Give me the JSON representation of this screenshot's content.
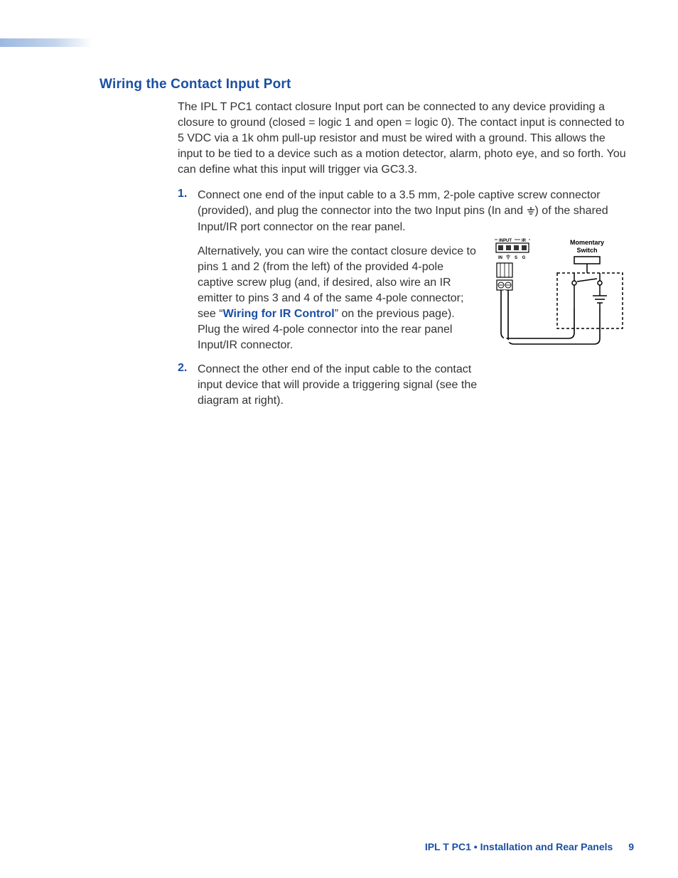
{
  "heading": "Wiring the Contact Input Port",
  "intro": "The IPL T PC1 contact closure Input port can be connected to any device providing a closure to ground (closed = logic 1 and open = logic 0). The contact input is connected to 5 VDC via a 1k ohm pull-up resistor and must be wired with a ground. This allows the input to be tied to a device such as a motion detector, alarm, photo eye, and so forth. You can define what this input will trigger via GC3.3.",
  "step1": {
    "num": "1.",
    "para1a": "Connect one end of the input cable to a 3.5 mm, 2-pole captive screw connector (provided), and plug the connector into the two Input pins (In and ",
    "para1b": ") of the shared Input/IR port connector on the rear panel.",
    "para2a": "Alternatively, you can wire the contact closure device to pins 1 and 2 (from the left) of the provided 4-pole captive screw plug (and, if desired, also wire an IR emitter to pins 3 and 4 of the same 4-pole connector; see “",
    "link": "Wiring for IR Control",
    "para2b": "” on the previous page). Plug the wired 4-pole connector into the rear panel Input/IR connector."
  },
  "step2": {
    "num": "2.",
    "text": "Connect the other end of the input cable to the contact input device that will provide a triggering signal (see the diagram at right)."
  },
  "diagram": {
    "label_switch1": "Momentary",
    "label_switch2": "Switch",
    "pin_input": "INPUT",
    "pin_ir": "IR",
    "pin_in": "IN",
    "pin_s": "S",
    "pin_g": "G"
  },
  "footer": {
    "title": "IPL T PC1 • Installation and Rear Panels",
    "page": "9"
  }
}
